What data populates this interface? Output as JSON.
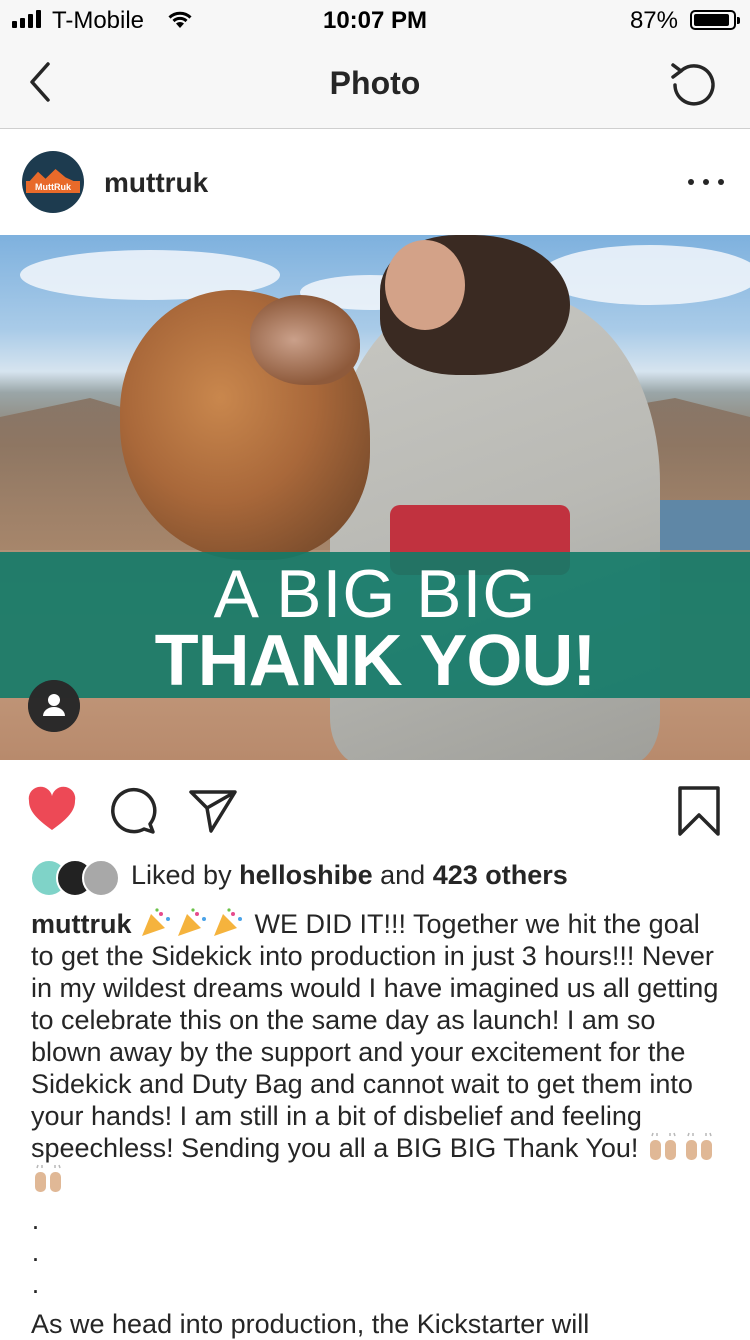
{
  "status_bar": {
    "carrier": "T-Mobile",
    "time": "10:07 PM",
    "battery_percent": "87%"
  },
  "nav": {
    "title": "Photo"
  },
  "post": {
    "username": "muttruk",
    "avatar_text": "MuttRuk",
    "banner_line1": "A BIG BIG",
    "banner_line2": "THANK YOU!",
    "likes": {
      "prefix": "Liked by",
      "user": "helloshibe",
      "middle": "and",
      "others": "423 others"
    },
    "caption": {
      "username": "muttruk",
      "text_part1": "WE DID IT!!! Together we hit the goal to get the Sidekick into production in just 3 hours!!! Never in my wildest dreams would I have imagined us all getting to celebrate this on the same day as launch! I am so blown away by the support and your excitement for the Sidekick and Duty Bag and cannot wait to get them into your hands! I am still in a bit of disbelief and feeling speechless! Sending you all a BIG BIG Thank You!",
      "dots": [
        "·",
        "·",
        "·"
      ],
      "text_part2": "As we head into production, the Kickstarter will"
    }
  },
  "colors": {
    "like_red": "#ed4956",
    "banner_green": "#127a68",
    "text": "#262626"
  },
  "icons": [
    "back-icon",
    "refresh-icon",
    "more-icon",
    "heart-icon",
    "comment-icon",
    "share-icon",
    "bookmark-icon",
    "person-icon",
    "party-popper-icon",
    "raised-hands-icon"
  ]
}
